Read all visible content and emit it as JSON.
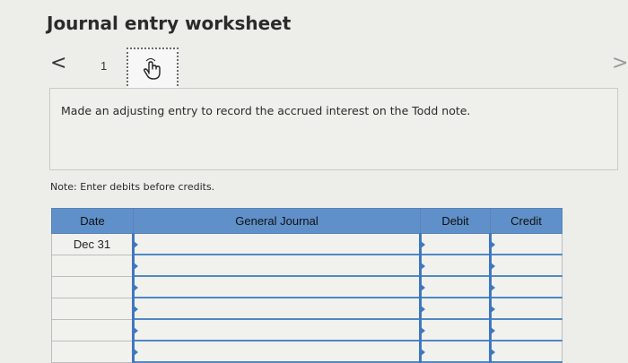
{
  "title": "Journal entry worksheet",
  "nav": {
    "prev_glyph": "<",
    "current": "1",
    "next_glyph": ">"
  },
  "entry_tab_icon": "hand-pointer-icon",
  "description": "Made an adjusting entry to record the accrued interest on the Todd note.",
  "note": "Note: Enter debits before credits.",
  "table": {
    "headers": [
      "Date",
      "General Journal",
      "Debit",
      "Credit"
    ],
    "rows": [
      {
        "date": "Dec 31"
      },
      {
        "date": ""
      },
      {
        "date": ""
      },
      {
        "date": ""
      },
      {
        "date": ""
      },
      {
        "date": ""
      }
    ]
  },
  "colors": {
    "header_bg": "#5f90c9",
    "input_border": "#3f78be",
    "page_bg": "#ededea"
  }
}
